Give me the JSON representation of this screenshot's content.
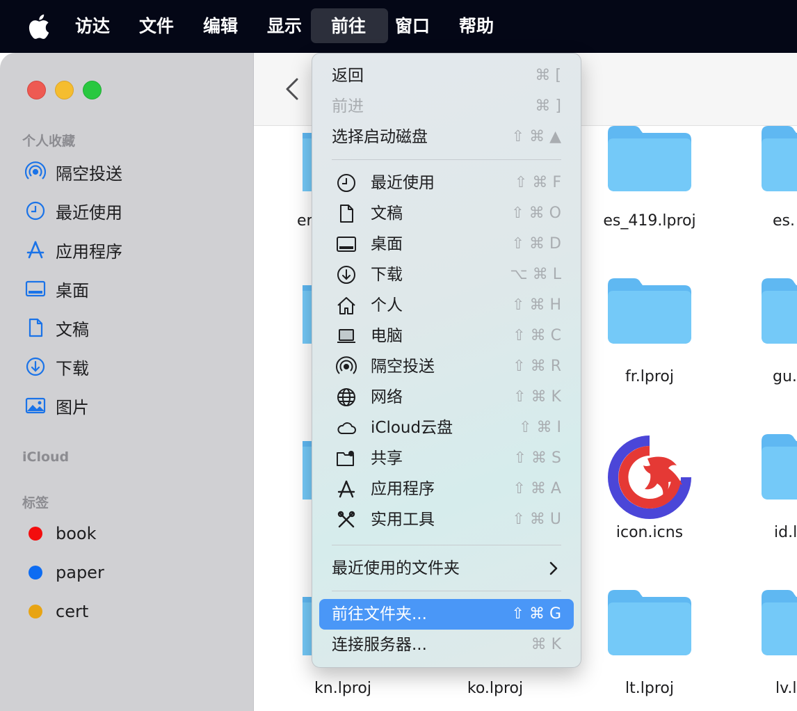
{
  "menubar": {
    "items": [
      "访达",
      "文件",
      "编辑",
      "显示",
      "前往",
      "窗口",
      "帮助"
    ],
    "active": "前往"
  },
  "sidebar": {
    "favorites_title": "个人收藏",
    "favorites": [
      {
        "label": "隔空投送",
        "icon": "airdrop-icon"
      },
      {
        "label": "最近使用",
        "icon": "clock-icon"
      },
      {
        "label": "应用程序",
        "icon": "applications-icon"
      },
      {
        "label": "桌面",
        "icon": "desktop-icon"
      },
      {
        "label": "文稿",
        "icon": "document-icon"
      },
      {
        "label": "下载",
        "icon": "download-icon"
      },
      {
        "label": "图片",
        "icon": "pictures-icon"
      }
    ],
    "icloud_title": "iCloud",
    "tags_title": "标签",
    "tags": [
      {
        "label": "book",
        "color": "#f30d0e"
      },
      {
        "label": "paper",
        "color": "#0d6cf2"
      },
      {
        "label": "cert",
        "color": "#e8a413"
      }
    ]
  },
  "files": {
    "row1": [
      "er",
      "es_419.lproj",
      "es."
    ],
    "row2": [
      "fr.lproj",
      "gu."
    ],
    "row3": [
      "icon.icns",
      "id.l"
    ],
    "row4": [
      "kn.lproj",
      "ko.lproj",
      "lt.lproj",
      "lv.l"
    ]
  },
  "menu": {
    "back": {
      "label": "返回",
      "shortcut": "⌘ ["
    },
    "forward": {
      "label": "前进",
      "shortcut": "⌘ ]"
    },
    "startup_disk": {
      "label": "选择启动磁盘",
      "shortcut": "⇧ ⌘ ▲"
    },
    "places": [
      {
        "label": "最近使用",
        "shortcut": "⇧ ⌘ F",
        "icon": "clock-icon"
      },
      {
        "label": "文稿",
        "shortcut": "⇧ ⌘ O",
        "icon": "document-icon"
      },
      {
        "label": "桌面",
        "shortcut": "⇧ ⌘ D",
        "icon": "desktop-icon"
      },
      {
        "label": "下载",
        "shortcut": "⌥ ⌘ L",
        "icon": "download-icon"
      },
      {
        "label": "个人",
        "shortcut": "⇧ ⌘ H",
        "icon": "home-icon"
      },
      {
        "label": "电脑",
        "shortcut": "⇧ ⌘ C",
        "icon": "laptop-icon"
      },
      {
        "label": "隔空投送",
        "shortcut": "⇧ ⌘ R",
        "icon": "airdrop-icon"
      },
      {
        "label": "网络",
        "shortcut": "⇧ ⌘ K",
        "icon": "globe-icon"
      },
      {
        "label": "iCloud云盘",
        "shortcut": "⇧ ⌘ I",
        "icon": "cloud-icon"
      },
      {
        "label": "共享",
        "shortcut": "⇧ ⌘ S",
        "icon": "shared-folder-icon"
      },
      {
        "label": "应用程序",
        "shortcut": "⇧ ⌘ A",
        "icon": "applications-icon"
      },
      {
        "label": "实用工具",
        "shortcut": "⇧ ⌘ U",
        "icon": "utilities-icon"
      }
    ],
    "recent_folders": {
      "label": "最近使用的文件夹"
    },
    "go_to_folder": {
      "label": "前往文件夹...",
      "shortcut": "⇧ ⌘ G"
    },
    "connect_server": {
      "label": "连接服务器...",
      "shortcut": "⌘ K"
    }
  },
  "colors": {
    "menubar_bg": "#040716",
    "highlight": "#4a97f7",
    "sidebar_accent": "#1a73e8",
    "folder": "#5fb8f2"
  }
}
